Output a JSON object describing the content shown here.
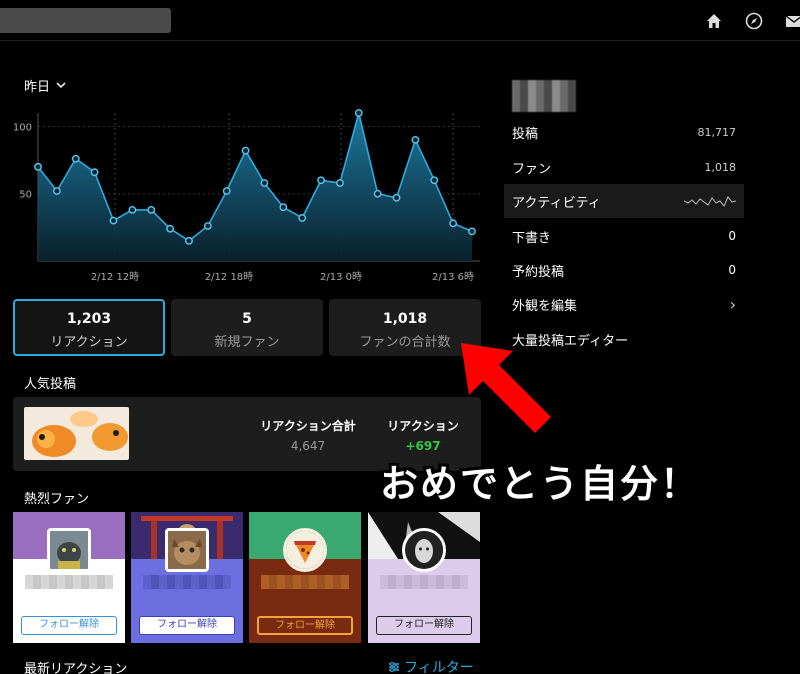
{
  "topbar": {
    "icons": [
      "home-icon",
      "compass-icon",
      "mail-icon"
    ]
  },
  "dashboard": {
    "period_label": "昨日",
    "stats": [
      {
        "value": "1,203",
        "label": "リアクション",
        "active": true
      },
      {
        "value": "5",
        "label": "新規ファン",
        "active": false
      },
      {
        "value": "1,018",
        "label": "ファンの合計数",
        "active": false
      }
    ],
    "popular_title": "人気投稿",
    "popular_post": {
      "total_header": "リアクション合計",
      "total_value": "4,647",
      "reactions_header": "リアクション",
      "reactions_value": "+697"
    },
    "fans_title": "熱烈ファン",
    "fans": [
      {
        "button": "フォロー解除",
        "banner_color": "#9b6fc0",
        "body_color": "#ffffff",
        "button_color": "#3b8fd6"
      },
      {
        "button": "フォロー解除",
        "banner_color": "#3a2b6e",
        "body_color": "#6b6fe0",
        "button_color": "#3b3fb0"
      },
      {
        "button": "フォロー解除",
        "banner_color": "#3aa96f",
        "body_color": "#7a2a10",
        "button_color": "#f2a33a"
      },
      {
        "button": "フォロー解除",
        "banner_color": "#111111",
        "body_color": "#dccbeb",
        "button_color": "#222222"
      }
    ],
    "latest_title": "最新リアクション",
    "filter_label": "フィルター"
  },
  "chart_data": {
    "type": "area",
    "x_ticks": [
      "2/12 12時",
      "2/12 18時",
      "2/13 0時",
      "2/13 6時"
    ],
    "y_ticks": [
      "100",
      "50"
    ],
    "ylim": [
      0,
      110
    ],
    "grid": true,
    "values": [
      70,
      52,
      76,
      66,
      30,
      38,
      38,
      24,
      15,
      26,
      52,
      82,
      58,
      40,
      32,
      60,
      58,
      110,
      50,
      47,
      90,
      60,
      28,
      22
    ],
    "color": "#2eaadc"
  },
  "sidebar": {
    "items": [
      {
        "label": "投稿",
        "value": "81,717"
      },
      {
        "label": "ファン",
        "value": "1,018"
      },
      {
        "label": "アクティビティ",
        "value": ""
      },
      {
        "label": "下書き",
        "value": "0"
      },
      {
        "label": "予約投稿",
        "value": "0"
      },
      {
        "label": "外観を編集",
        "value": "›"
      },
      {
        "label": "大量投稿エディター",
        "value": ""
      }
    ]
  },
  "annotation": {
    "text": "おめでとう自分！",
    "arrow_color": "#ff0000"
  }
}
